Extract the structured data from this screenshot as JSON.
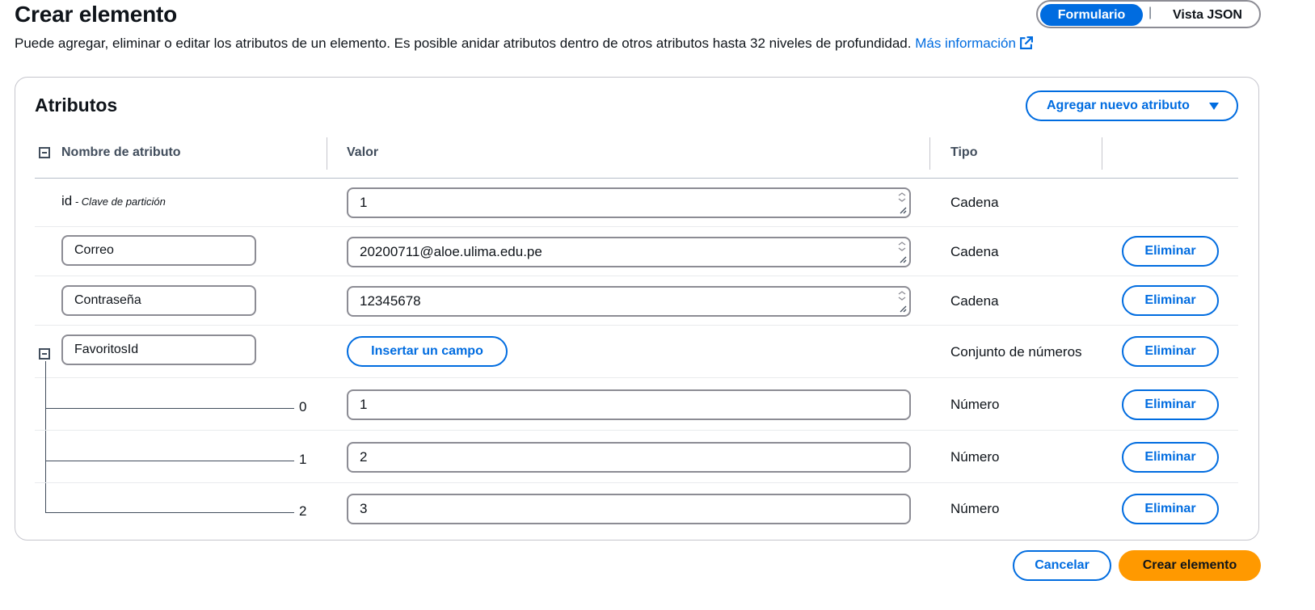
{
  "header": {
    "title": "Crear elemento",
    "description": "Puede agregar, eliminar o editar los atributos de un elemento. Es posible anidar atributos dentro de otros atributos hasta 32 niveles de profundidad.",
    "more_info_link": "Más información",
    "more_info_icon": "external-link-icon"
  },
  "view_toggle": {
    "active": "Formulario",
    "separator": "|",
    "inactive": "Vista JSON"
  },
  "attributes_panel": {
    "title": "Atributos",
    "add_button": "Agregar nuevo atributo",
    "columns": {
      "name": "Nombre de atributo",
      "value": "Valor",
      "type": "Tipo"
    },
    "partition_key": {
      "name": "id",
      "suffix": " - Clave de partición",
      "value": "1",
      "type": "Cadena"
    },
    "rows": [
      {
        "name": "Correo",
        "value": "20200711@aloe.ulima.edu.pe",
        "type": "Cadena",
        "remove": "Eliminar"
      },
      {
        "name": "Contraseña",
        "value": "12345678",
        "type": "Cadena",
        "remove": "Eliminar"
      }
    ],
    "set_attribute": {
      "name": "FavoritosId",
      "insert_button": "Insertar un campo",
      "type": "Conjunto de números",
      "remove": "Eliminar",
      "items": [
        {
          "index": "0",
          "value": "1",
          "type": "Número",
          "remove": "Eliminar"
        },
        {
          "index": "1",
          "value": "2",
          "type": "Número",
          "remove": "Eliminar"
        },
        {
          "index": "2",
          "value": "3",
          "type": "Número",
          "remove": "Eliminar"
        }
      ]
    }
  },
  "footer": {
    "cancel": "Cancelar",
    "create": "Crear elemento"
  },
  "colors": {
    "primary": "#006ce0",
    "create_button": "#ff9900",
    "text": "#0f141a",
    "border": "#8c8c94"
  }
}
